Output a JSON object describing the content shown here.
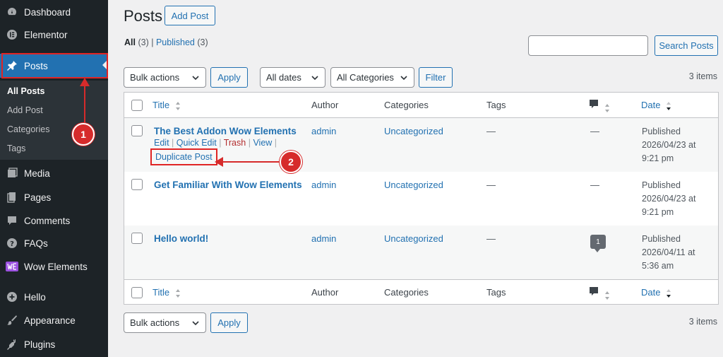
{
  "sidebar": {
    "menu": [
      {
        "label": "Dashboard",
        "icon": "dashboard-icon"
      },
      {
        "label": "Elementor",
        "icon": "elementor-icon"
      },
      {
        "label": "Posts",
        "icon": "pin-icon"
      },
      {
        "label": "Media",
        "icon": "media-icon"
      },
      {
        "label": "Pages",
        "icon": "pages-icon"
      },
      {
        "label": "Comments",
        "icon": "comments-icon"
      },
      {
        "label": "FAQs",
        "icon": "help-icon"
      },
      {
        "label": "Wow Elements",
        "icon": "wow-elements-icon"
      },
      {
        "label": "Hello",
        "icon": "plus-circle-icon"
      },
      {
        "label": "Appearance",
        "icon": "brush-icon"
      },
      {
        "label": "Plugins",
        "icon": "plugin-icon"
      }
    ],
    "submenu": [
      "All Posts",
      "Add Post",
      "Categories",
      "Tags"
    ]
  },
  "header": {
    "title": "Posts",
    "add_post_label": "Add Post"
  },
  "filters": {
    "all_label": "All",
    "all_count": "(3)",
    "published_label": "Published",
    "published_count": "(3)",
    "search_button": "Search Posts",
    "bulk_actions": "Bulk actions",
    "apply": "Apply",
    "all_dates": "All dates",
    "all_categories": "All Categories",
    "filter": "Filter",
    "items_count": "3 items"
  },
  "table": {
    "columns": {
      "title": "Title",
      "author": "Author",
      "categories": "Categories",
      "tags": "Tags",
      "date": "Date"
    },
    "rows": [
      {
        "title": "The Best Addon Wow Elements",
        "author": "admin",
        "category": "Uncategorized",
        "tags": "—",
        "comments": "—",
        "date_status": "Published",
        "date_line1": "2026/04/23 at",
        "date_line2": "9:21 pm"
      },
      {
        "title": "Get Familiar With Wow Elements",
        "author": "admin",
        "category": "Uncategorized",
        "tags": "—",
        "comments": "—",
        "date_status": "Published",
        "date_line1": "2026/04/23 at",
        "date_line2": "9:21 pm"
      },
      {
        "title": "Hello world!",
        "author": "admin",
        "category": "Uncategorized",
        "tags": "—",
        "comments": "1",
        "date_status": "Published",
        "date_line1": "2026/04/11 at",
        "date_line2": "5:36 am"
      }
    ],
    "row_actions": {
      "edit": "Edit",
      "quick_edit": "Quick Edit",
      "trash": "Trash",
      "view": "View",
      "separator": "|",
      "duplicate": "Duplicate Post"
    }
  },
  "annotations": {
    "step1": "1",
    "step2": "2"
  },
  "colors": {
    "accent": "#2271b1",
    "sidebar": "#1d2327",
    "annotation": "#d62b2b",
    "trash": "#b32d2e"
  }
}
